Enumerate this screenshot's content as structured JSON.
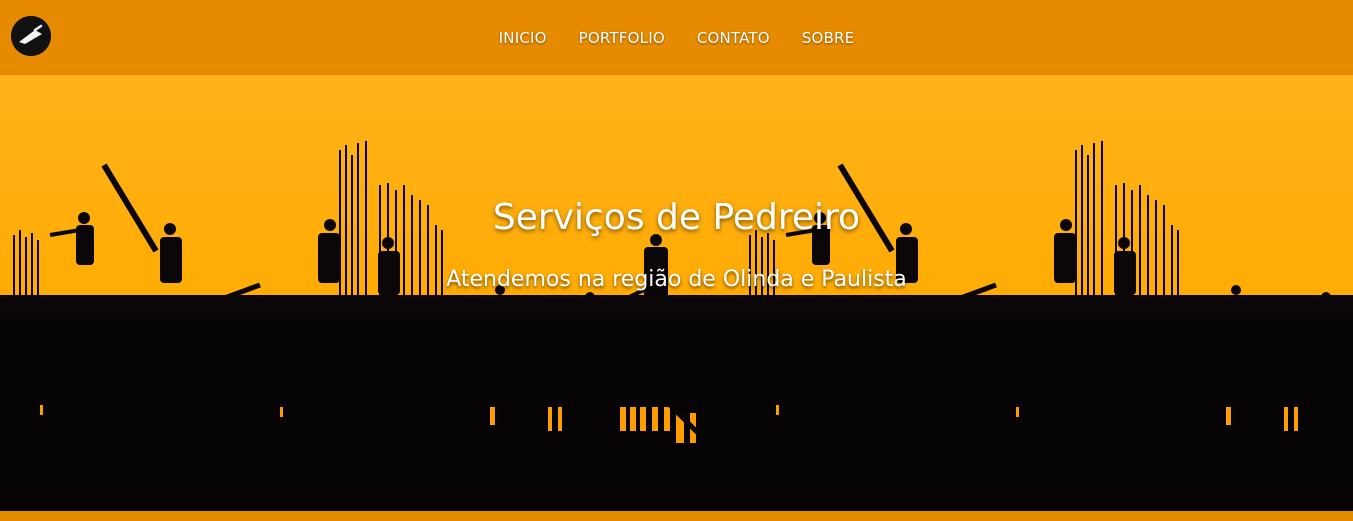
{
  "brand": {
    "logo_icon": "trowel-icon"
  },
  "nav": {
    "items": [
      {
        "label": "INICIO"
      },
      {
        "label": "PORTFOLIO"
      },
      {
        "label": "CONTATO"
      },
      {
        "label": "SOBRE"
      }
    ]
  },
  "hero": {
    "title": "Serviços de Pedreiro",
    "subtitle": "Atendemos na região de Olinda e Paulista"
  },
  "colors": {
    "header": "#e68a00",
    "sky_top": "#ffb000",
    "sky_glow": "#ffc23a",
    "silhouette": "#070406"
  }
}
